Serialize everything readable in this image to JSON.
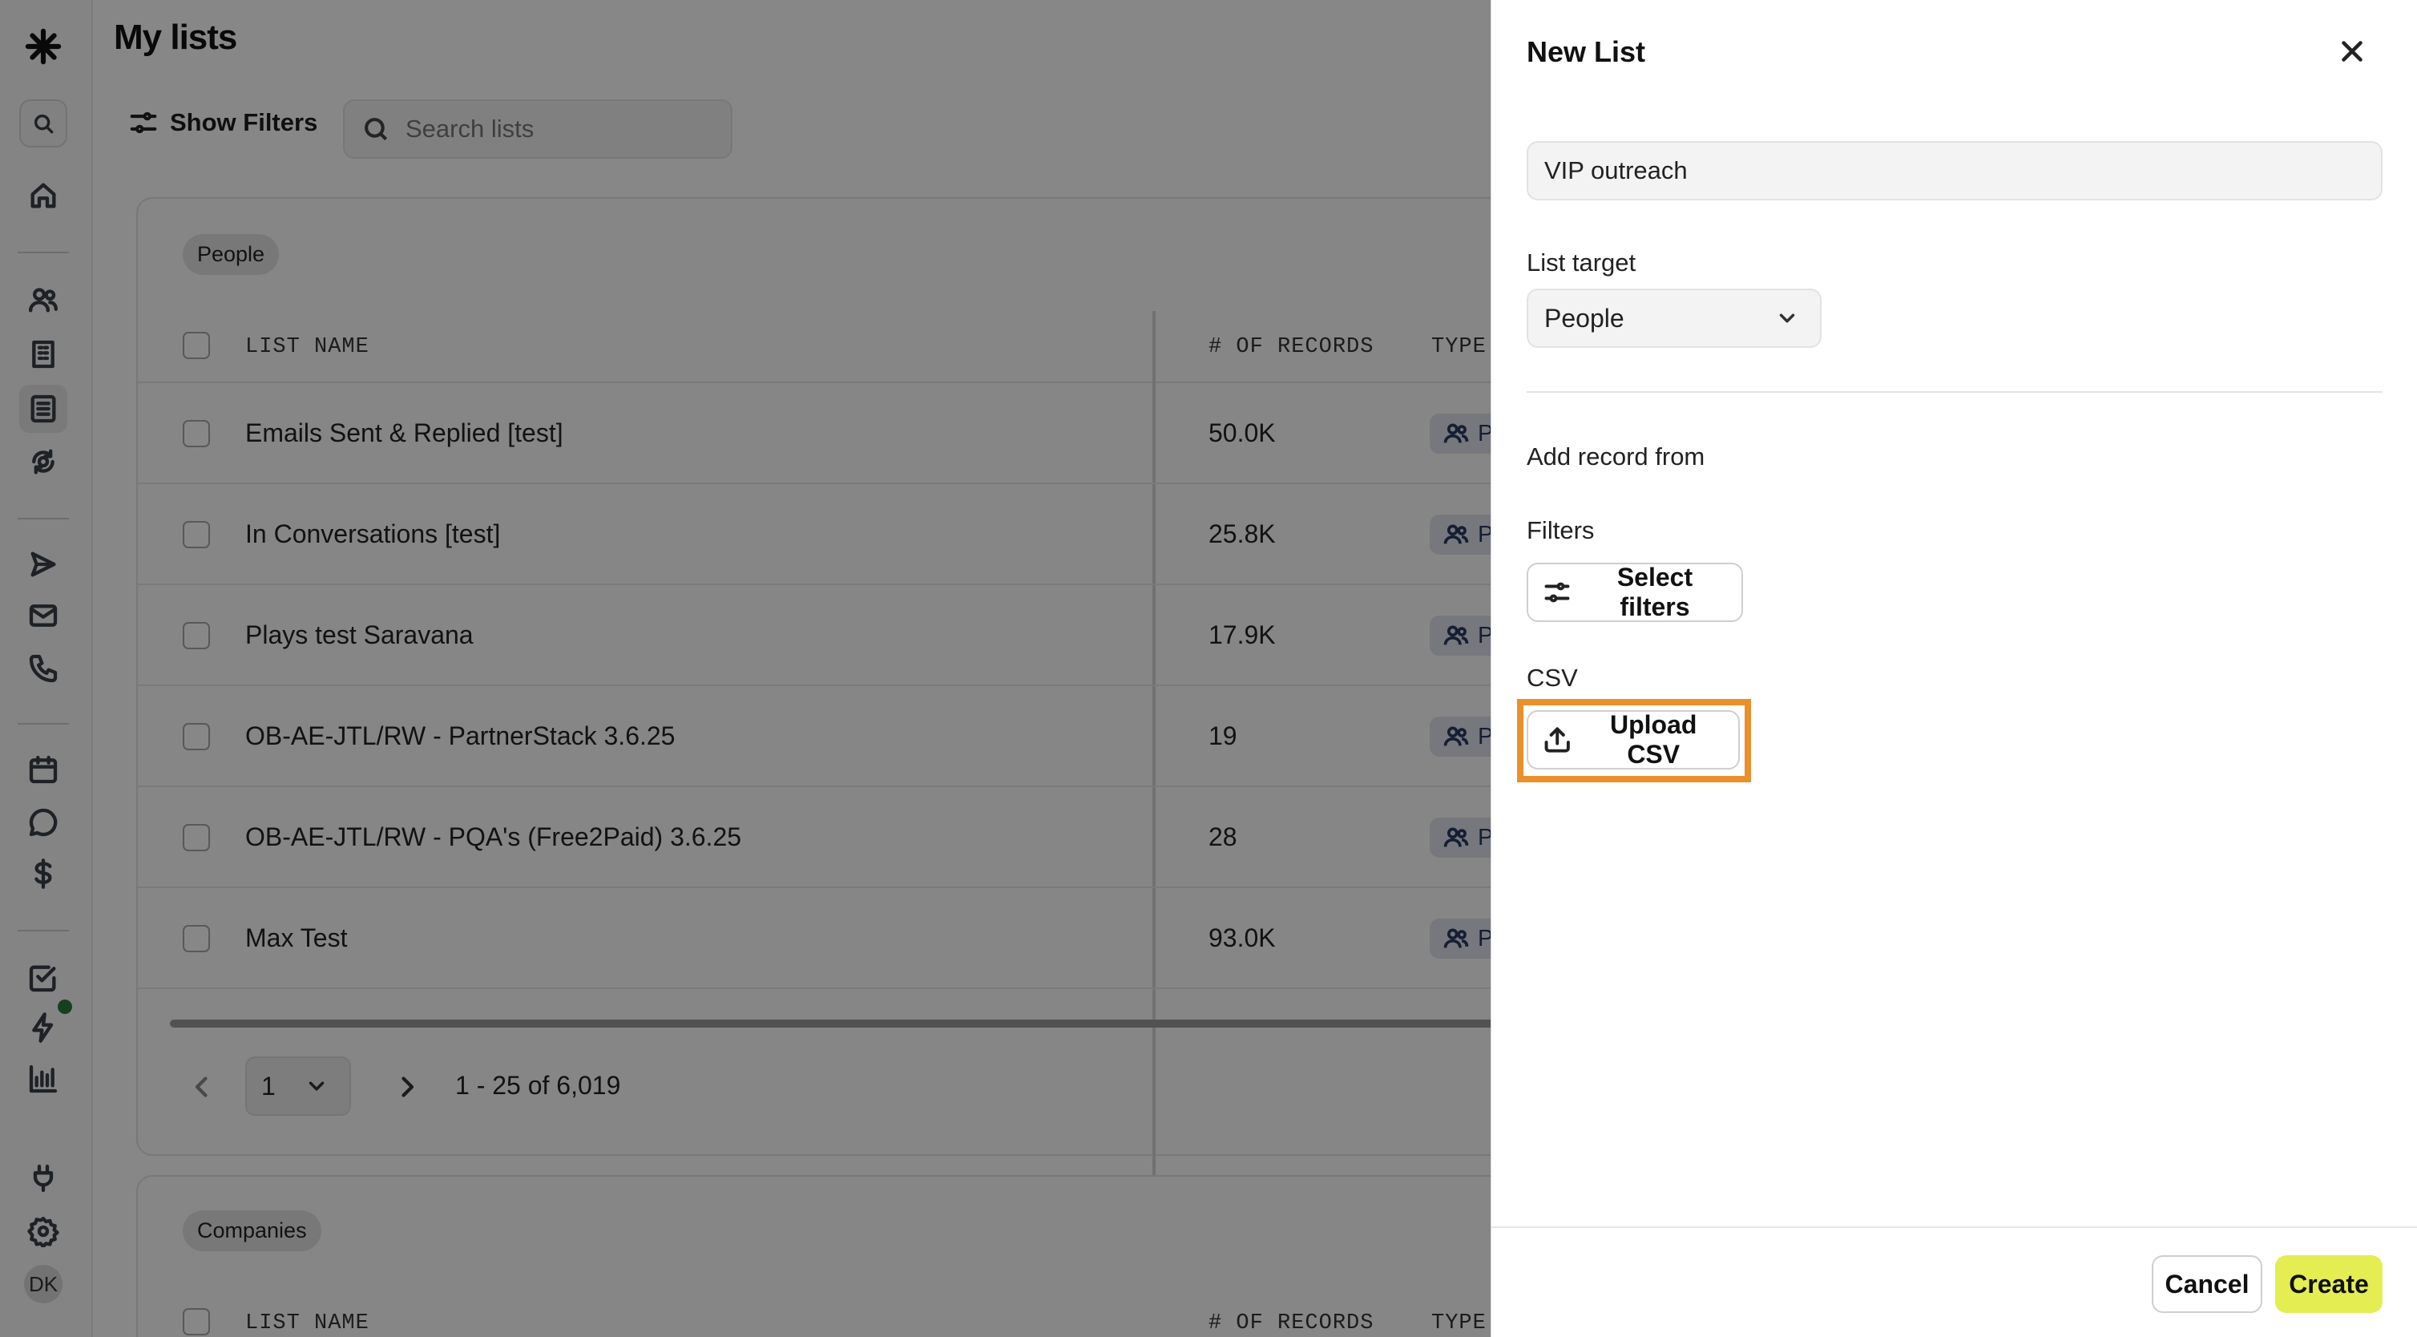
{
  "app": {
    "user_initials": "DK"
  },
  "page": {
    "title": "My lists"
  },
  "toolbar": {
    "show_filters_label": "Show Filters",
    "search_placeholder": "Search lists"
  },
  "people_section": {
    "label": "People",
    "columns": {
      "list_name": "LIST NAME",
      "records": "# OF RECORDS",
      "type": "TYPE"
    },
    "rows": [
      {
        "name": "Emails Sent & Replied [test]",
        "records": "50.0K",
        "type": "Peop"
      },
      {
        "name": "In Conversations [test]",
        "records": "25.8K",
        "type": "Peop"
      },
      {
        "name": "Plays test Saravana",
        "records": "17.9K",
        "type": "Peop"
      },
      {
        "name": "OB-AE-JTL/RW - PartnerStack 3.6.25",
        "records": "19",
        "type": "Peop"
      },
      {
        "name": "OB-AE-JTL/RW - PQA's (Free2Paid) 3.6.25",
        "records": "28",
        "type": "Peop"
      },
      {
        "name": "Max Test",
        "records": "93.0K",
        "type": "Peop"
      }
    ],
    "pagination": {
      "page": "1",
      "range": "1 - 25 of 6,019"
    }
  },
  "companies_section": {
    "label": "Companies",
    "columns": {
      "list_name": "LIST NAME",
      "records": "# OF RECORDS",
      "type": "TYPE"
    }
  },
  "panel": {
    "title": "New List",
    "name_value": "VIP outreach",
    "list_target_label": "List target",
    "list_target_value": "People",
    "add_record_from_label": "Add record from",
    "filters_label": "Filters",
    "select_filters_label": "Select filters",
    "csv_label": "CSV",
    "upload_csv_label": "Upload CSV",
    "cancel_label": "Cancel",
    "create_label": "Create"
  },
  "colors": {
    "highlight": "#ea8f2a",
    "create_button": "#e4ed52",
    "badge_bg": "#dfe3ec"
  }
}
